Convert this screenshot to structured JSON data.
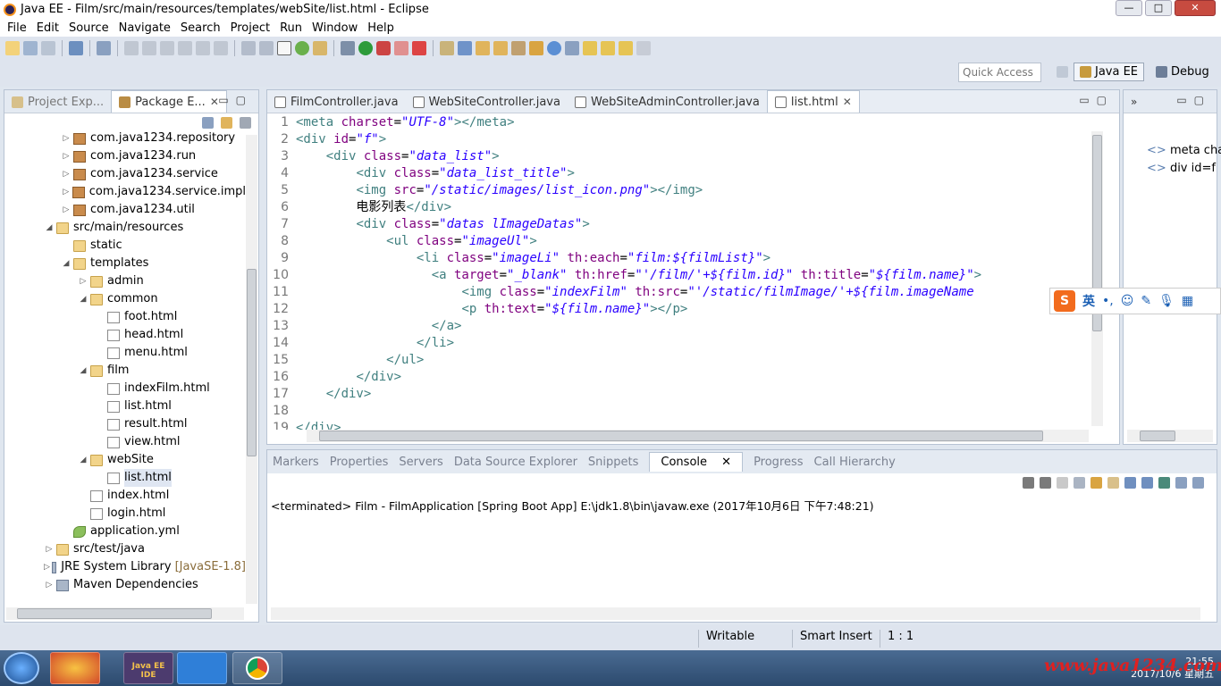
{
  "window": {
    "title": "Java EE - Film/src/main/resources/templates/webSite/list.html - Eclipse"
  },
  "menu": [
    "File",
    "Edit",
    "Source",
    "Navigate",
    "Search",
    "Project",
    "Run",
    "Window",
    "Help"
  ],
  "quick_access": "Quick Access",
  "perspectives": {
    "javaee": "Java EE",
    "debug": "Debug"
  },
  "left_tabs": {
    "project_explorer": "Project Exp...",
    "package_explorer": "Package E..."
  },
  "tree": [
    {
      "label": "com.java1234.repository",
      "indent": 1,
      "type": "pkg",
      "tw": "▷"
    },
    {
      "label": "com.java1234.run",
      "indent": 1,
      "type": "pkg",
      "tw": "▷"
    },
    {
      "label": "com.java1234.service",
      "indent": 1,
      "type": "pkg",
      "tw": "▷"
    },
    {
      "label": "com.java1234.service.impl",
      "indent": 1,
      "type": "pkg",
      "tw": "▷"
    },
    {
      "label": "com.java1234.util",
      "indent": 1,
      "type": "pkg",
      "tw": "▷"
    },
    {
      "label": "src/main/resources",
      "indent": 0,
      "type": "folder",
      "tw": "◢"
    },
    {
      "label": "static",
      "indent": 1,
      "type": "folder",
      "tw": ""
    },
    {
      "label": "templates",
      "indent": 1,
      "type": "folder",
      "tw": "◢"
    },
    {
      "label": "admin",
      "indent": 2,
      "type": "folder",
      "tw": "▷"
    },
    {
      "label": "common",
      "indent": 2,
      "type": "folder",
      "tw": "◢"
    },
    {
      "label": "foot.html",
      "indent": 3,
      "type": "file",
      "tw": ""
    },
    {
      "label": "head.html",
      "indent": 3,
      "type": "file",
      "tw": ""
    },
    {
      "label": "menu.html",
      "indent": 3,
      "type": "file",
      "tw": ""
    },
    {
      "label": "film",
      "indent": 2,
      "type": "folder",
      "tw": "◢"
    },
    {
      "label": "indexFilm.html",
      "indent": 3,
      "type": "file",
      "tw": ""
    },
    {
      "label": "list.html",
      "indent": 3,
      "type": "file",
      "tw": ""
    },
    {
      "label": "result.html",
      "indent": 3,
      "type": "file",
      "tw": ""
    },
    {
      "label": "view.html",
      "indent": 3,
      "type": "file",
      "tw": ""
    },
    {
      "label": "webSite",
      "indent": 2,
      "type": "folder",
      "tw": "◢"
    },
    {
      "label": "list.html",
      "indent": 3,
      "type": "file",
      "tw": "",
      "selected": true
    },
    {
      "label": "index.html",
      "indent": 2,
      "type": "file",
      "tw": ""
    },
    {
      "label": "login.html",
      "indent": 2,
      "type": "file",
      "tw": ""
    },
    {
      "label": "application.yml",
      "indent": 1,
      "type": "yml",
      "tw": ""
    },
    {
      "label": "src/test/java",
      "indent": 0,
      "type": "folder",
      "tw": "▷"
    },
    {
      "label": "JRE System Library",
      "suffix": "[JavaSE-1.8]",
      "indent": 0,
      "type": "lib",
      "tw": "▷"
    },
    {
      "label": "Maven Dependencies",
      "indent": 0,
      "type": "lib",
      "tw": "▷"
    }
  ],
  "editor_tabs": [
    "FilmController.java",
    "WebSiteController.java",
    "WebSiteAdminController.java",
    "list.html"
  ],
  "code_lines": [
    "<meta charset=\"UTF-8\"></meta>",
    "<div id=\"f\">",
    "    <div class=\"data_list\">",
    "        <div class=\"data_list_title\">",
    "        <img src=\"/static/images/list_icon.png\"></img>",
    "        电影列表</div>",
    "        <div class=\"datas lImageDatas\">",
    "            <ul class=\"imageUl\">",
    "                <li class=\"imageLi\" th:each=\"film:${filmList}\">",
    "                  <a target=\"_blank\" th:href=\"'/film/'+${film.id}\" th:title=\"${film.name}\">",
    "                      <img class=\"indexFilm\" th:src=\"'/static/filmImage/'+${film.imageName",
    "                      <p th:text=\"${film.name}\"></p>",
    "                  </a>",
    "                </li>",
    "            </ul>",
    "        </div>",
    "    </div>",
    "",
    "</div>"
  ],
  "outline": [
    "meta char",
    "div id=f"
  ],
  "bottom_tabs": [
    "Markers",
    "Properties",
    "Servers",
    "Data Source Explorer",
    "Snippets",
    "Console",
    "Progress",
    "Call Hierarchy"
  ],
  "console_text": "<terminated> Film - FilmApplication [Spring Boot App] E:\\jdk1.8\\bin\\javaw.exe (2017年10月6日 下午7:48:21)",
  "status": {
    "writable": "Writable",
    "insert": "Smart Insert",
    "position": "1 : 1"
  },
  "ime": {
    "logo": "S",
    "lang": "英"
  },
  "taskbar": {
    "time": "21:55",
    "date": "2017/10/6 星期五",
    "app_label": "Java EE IDE"
  },
  "watermark": "www.java1234.com"
}
